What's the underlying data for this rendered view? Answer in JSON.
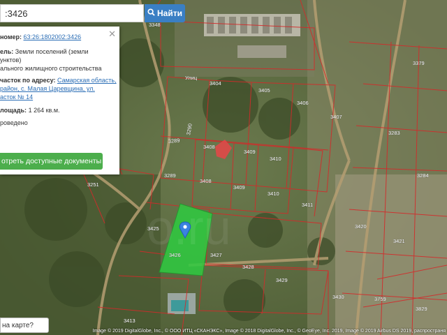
{
  "search": {
    "value": ":3426",
    "button_label": "Найти"
  },
  "info_panel": {
    "cadastral_number_label": "номер:",
    "cadastral_number": "63:26:1802002:3426",
    "category_label": "ель:",
    "category_value": "Земли поселений (земли",
    "category_value_2": "унктов)",
    "use_value": "ального жилищного строительства",
    "address_label": "часток по адресу:",
    "address_value_1": "Самарская область,",
    "address_value_2": "район, с. Малая Царевщина, ул.",
    "address_value_3": "асток № 14",
    "area_label": "лощадь:",
    "area_value": "1 264 кв.м.",
    "survey_value": "роведено",
    "docs_button": "отреть доступные документы"
  },
  "bottom_question": "на карте?",
  "attribution": "Image © 2019 DigitalGlobe, Inc., © ООО ИТЦ «СКАНЭКС», Image © 2018 DigitalGlobe, Inc., © GeoEye, Inc. 2019, Image © 2019 Airbus DS 2019, распространя",
  "map_labels": [
    {
      "id": "3348",
      "text": "3348"
    },
    {
      "id": "3404",
      "text": "3404"
    },
    {
      "id": "3405",
      "text": "3405"
    },
    {
      "id": "3406",
      "text": "3406"
    },
    {
      "id": "3407",
      "text": "3407"
    },
    {
      "id": "3379",
      "text": "3379"
    },
    {
      "id": "3289a",
      "text": "3289"
    },
    {
      "id": "3290",
      "text": "3290"
    },
    {
      "id": "3408a",
      "text": "3408"
    },
    {
      "id": "3409a",
      "text": "3409"
    },
    {
      "id": "3410a",
      "text": "3410"
    },
    {
      "id": "3283",
      "text": "3283"
    },
    {
      "id": "3289b",
      "text": "3289"
    },
    {
      "id": "3408b",
      "text": "3408"
    },
    {
      "id": "3409b",
      "text": "3409"
    },
    {
      "id": "3410b",
      "text": "3410"
    },
    {
      "id": "3284",
      "text": "3284"
    },
    {
      "id": "3251",
      "text": "3251"
    },
    {
      "id": "3411",
      "text": "3411"
    },
    {
      "id": "3425",
      "text": "3425"
    },
    {
      "id": "3426",
      "text": "3426"
    },
    {
      "id": "3427",
      "text": "3427"
    },
    {
      "id": "3420",
      "text": "3420"
    },
    {
      "id": "3421",
      "text": "3421"
    },
    {
      "id": "3428",
      "text": "3428"
    },
    {
      "id": "3429",
      "text": "3429"
    },
    {
      "id": "3430",
      "text": "3430"
    },
    {
      "id": "3759",
      "text": "3759"
    },
    {
      "id": "3829",
      "text": "3829"
    },
    {
      "id": "3413",
      "text": "3413"
    }
  ],
  "street_label": "Улиц",
  "colors": {
    "selected_parcel": "#2ecc40",
    "parcel_border": "#d42a2a",
    "button_blue": "#3a7fc4",
    "button_green": "#4cae4c",
    "marker": "#3b82e0"
  }
}
